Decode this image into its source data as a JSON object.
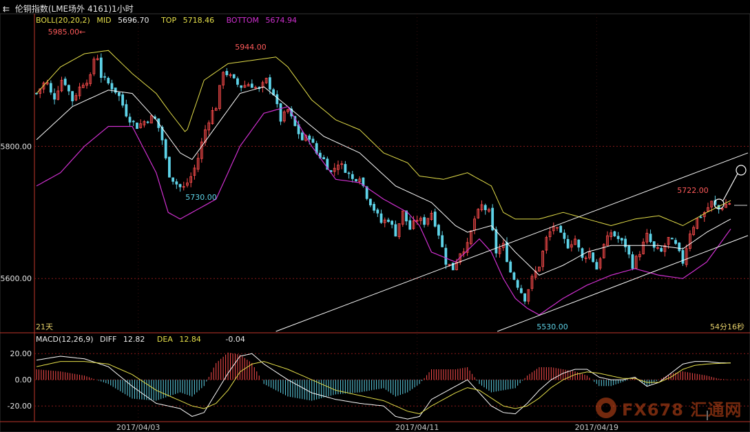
{
  "header": {
    "title": "伦铜指数(LME场外 4161)1小时",
    "title_icon": "back-arrows-icon"
  },
  "boll": {
    "name": "BOLL(20,20,2)",
    "mid_label": "MID",
    "mid_value": "5696.70",
    "top_label": "TOP",
    "top_value": "5718.46",
    "bottom_label": "BOTTOM",
    "bottom_value": "5674.94"
  },
  "macd": {
    "name": "MACD(12,26,9)",
    "diff_label": "DIFF",
    "diff_value": "12.82",
    "dea_label": "DEA",
    "dea_value": "12.84",
    "macd_value": "-0.04"
  },
  "footer": {
    "interval": "21天",
    "timer": "54分16秒"
  },
  "watermark": {
    "text": "FX678 汇通网"
  },
  "colors": {
    "up": "#ff4d4d",
    "down": "#5ed3e8",
    "mid": "#ffffff",
    "top": "#e6e04a",
    "bottom": "#d030d0",
    "grid": "#8a1a1a",
    "axis": "#c0392b",
    "price_annot_hi": "#ff5a5a",
    "price_annot_lo": "#5ed3e8",
    "trendline": "#ffffff"
  },
  "chart_data": [
    {
      "type": "candlestick",
      "title": "伦铜指数(LME场外 4161)1小时",
      "y_ticks": [
        5800.0,
        5600.0
      ],
      "y_tick_labels": [
        "5800.00",
        "5600.00"
      ],
      "ylim": [
        5520,
        5990
      ],
      "x_tick_labels": [
        "2017/04/03",
        "2017/04/11",
        "2017/04/19"
      ],
      "grid": true,
      "annotations": [
        {
          "label": "5985.00",
          "value": 5985.0,
          "kind": "high",
          "arrow": "←"
        },
        {
          "label": "5944.00",
          "value": 5944.0,
          "kind": "high"
        },
        {
          "label": "5730.00",
          "value": 5730.0,
          "kind": "low"
        },
        {
          "label": "5530.00",
          "value": 5530.0,
          "kind": "low"
        },
        {
          "label": "5722.00",
          "value": 5722.0,
          "kind": "high"
        }
      ],
      "close_path": [
        [
          0,
          5880
        ],
        [
          8,
          5900
        ],
        [
          14,
          5870
        ],
        [
          22,
          5905
        ],
        [
          30,
          5870
        ],
        [
          38,
          5895
        ],
        [
          46,
          5905
        ],
        [
          50,
          5960
        ],
        [
          52,
          5910
        ],
        [
          60,
          5895
        ],
        [
          68,
          5880
        ],
        [
          76,
          5845
        ],
        [
          84,
          5830
        ],
        [
          92,
          5840
        ],
        [
          98,
          5845
        ],
        [
          104,
          5820
        ],
        [
          110,
          5760
        ],
        [
          116,
          5745
        ],
        [
          122,
          5735
        ],
        [
          128,
          5750
        ],
        [
          134,
          5775
        ],
        [
          140,
          5820
        ],
        [
          146,
          5850
        ],
        [
          150,
          5860
        ],
        [
          156,
          5915
        ],
        [
          162,
          5905
        ],
        [
          170,
          5890
        ],
        [
          178,
          5895
        ],
        [
          186,
          5885
        ],
        [
          192,
          5900
        ],
        [
          198,
          5880
        ],
        [
          204,
          5840
        ],
        [
          210,
          5855
        ],
        [
          216,
          5830
        ],
        [
          222,
          5810
        ],
        [
          228,
          5815
        ],
        [
          234,
          5790
        ],
        [
          240,
          5780
        ],
        [
          246,
          5760
        ],
        [
          252,
          5775
        ],
        [
          258,
          5765
        ],
        [
          264,
          5750
        ],
        [
          270,
          5755
        ],
        [
          276,
          5725
        ],
        [
          282,
          5705
        ],
        [
          288,
          5685
        ],
        [
          294,
          5690
        ],
        [
          300,
          5668
        ],
        [
          306,
          5700
        ],
        [
          312,
          5675
        ],
        [
          318,
          5690
        ],
        [
          324,
          5685
        ],
        [
          330,
          5700
        ],
        [
          336,
          5668
        ],
        [
          342,
          5625
        ],
        [
          348,
          5615
        ],
        [
          354,
          5640
        ],
        [
          360,
          5650
        ],
        [
          366,
          5690
        ],
        [
          372,
          5710
        ],
        [
          378,
          5700
        ],
        [
          384,
          5640
        ],
        [
          390,
          5650
        ],
        [
          396,
          5610
        ],
        [
          402,
          5590
        ],
        [
          408,
          5570
        ],
        [
          414,
          5600
        ],
        [
          420,
          5620
        ],
        [
          426,
          5660
        ],
        [
          432,
          5680
        ],
        [
          438,
          5665
        ],
        [
          444,
          5650
        ],
        [
          450,
          5660
        ],
        [
          456,
          5630
        ],
        [
          462,
          5640
        ],
        [
          468,
          5615
        ],
        [
          474,
          5650
        ],
        [
          480,
          5670
        ],
        [
          486,
          5660
        ],
        [
          492,
          5650
        ],
        [
          498,
          5620
        ],
        [
          504,
          5640
        ],
        [
          510,
          5665
        ],
        [
          516,
          5645
        ],
        [
          522,
          5640
        ],
        [
          528,
          5660
        ],
        [
          534,
          5650
        ],
        [
          540,
          5625
        ],
        [
          546,
          5670
        ],
        [
          552,
          5690
        ],
        [
          558,
          5700
        ],
        [
          564,
          5715
        ],
        [
          570,
          5705
        ],
        [
          576,
          5712
        ],
        [
          580,
          5715
        ]
      ],
      "boll_mid": [
        [
          0,
          5810
        ],
        [
          30,
          5860
        ],
        [
          60,
          5885
        ],
        [
          80,
          5880
        ],
        [
          100,
          5840
        ],
        [
          120,
          5790
        ],
        [
          130,
          5780
        ],
        [
          150,
          5830
        ],
        [
          170,
          5880
        ],
        [
          190,
          5890
        ],
        [
          210,
          5860
        ],
        [
          240,
          5815
        ],
        [
          270,
          5790
        ],
        [
          300,
          5740
        ],
        [
          330,
          5715
        ],
        [
          350,
          5680
        ],
        [
          360,
          5670
        ],
        [
          380,
          5680
        ],
        [
          400,
          5640
        ],
        [
          420,
          5605
        ],
        [
          440,
          5620
        ],
        [
          460,
          5640
        ],
        [
          480,
          5650
        ],
        [
          500,
          5650
        ],
        [
          520,
          5650
        ],
        [
          540,
          5645
        ],
        [
          560,
          5670
        ],
        [
          580,
          5690
        ]
      ],
      "boll_top": [
        [
          0,
          5880
        ],
        [
          20,
          5920
        ],
        [
          40,
          5940
        ],
        [
          60,
          5945
        ],
        [
          80,
          5910
        ],
        [
          100,
          5880
        ],
        [
          110,
          5855
        ],
        [
          125,
          5820
        ],
        [
          140,
          5900
        ],
        [
          160,
          5925
        ],
        [
          180,
          5930
        ],
        [
          200,
          5935
        ],
        [
          210,
          5920
        ],
        [
          230,
          5870
        ],
        [
          250,
          5840
        ],
        [
          270,
          5825
        ],
        [
          290,
          5790
        ],
        [
          310,
          5775
        ],
        [
          320,
          5755
        ],
        [
          340,
          5750
        ],
        [
          360,
          5760
        ],
        [
          380,
          5740
        ],
        [
          390,
          5700
        ],
        [
          400,
          5690
        ],
        [
          420,
          5690
        ],
        [
          440,
          5700
        ],
        [
          460,
          5690
        ],
        [
          480,
          5680
        ],
        [
          500,
          5690
        ],
        [
          520,
          5695
        ],
        [
          540,
          5680
        ],
        [
          560,
          5700
        ],
        [
          580,
          5718
        ]
      ],
      "boll_bottom": [
        [
          0,
          5740
        ],
        [
          20,
          5760
        ],
        [
          40,
          5800
        ],
        [
          60,
          5830
        ],
        [
          80,
          5830
        ],
        [
          100,
          5760
        ],
        [
          110,
          5700
        ],
        [
          120,
          5690
        ],
        [
          130,
          5700
        ],
        [
          150,
          5720
        ],
        [
          170,
          5800
        ],
        [
          190,
          5850
        ],
        [
          210,
          5860
        ],
        [
          230,
          5800
        ],
        [
          250,
          5750
        ],
        [
          270,
          5745
        ],
        [
          290,
          5720
        ],
        [
          310,
          5700
        ],
        [
          320,
          5680
        ],
        [
          330,
          5640
        ],
        [
          350,
          5625
        ],
        [
          370,
          5660
        ],
        [
          380,
          5640
        ],
        [
          390,
          5600
        ],
        [
          400,
          5570
        ],
        [
          410,
          5555
        ],
        [
          420,
          5545
        ],
        [
          440,
          5570
        ],
        [
          460,
          5590
        ],
        [
          480,
          5605
        ],
        [
          500,
          5615
        ],
        [
          520,
          5605
        ],
        [
          540,
          5600
        ],
        [
          560,
          5625
        ],
        [
          580,
          5675
        ]
      ],
      "trendlines": [
        {
          "name": "channel-upper",
          "from": [
            200,
            5520
          ],
          "to": [
            580,
            5790
          ]
        },
        {
          "name": "channel-lower",
          "from": [
            385,
            5520
          ],
          "to": [
            580,
            5665
          ]
        }
      ]
    },
    {
      "type": "macd",
      "y_ticks": [
        20.0,
        0.0,
        -20.0
      ],
      "y_tick_labels": [
        "20.00",
        "0.00",
        "-20.00"
      ],
      "ylim": [
        -32,
        28
      ],
      "series": [
        {
          "name": "DIFF",
          "values_path": [
            [
              0,
              15
            ],
            [
              20,
              18
            ],
            [
              40,
              16
            ],
            [
              60,
              10
            ],
            [
              80,
              -5
            ],
            [
              100,
              -18
            ],
            [
              120,
              -22
            ],
            [
              130,
              -28
            ],
            [
              140,
              -25
            ],
            [
              150,
              -10
            ],
            [
              160,
              5
            ],
            [
              170,
              18
            ],
            [
              180,
              20
            ],
            [
              190,
              12
            ],
            [
              210,
              0
            ],
            [
              230,
              -10
            ],
            [
              250,
              -15
            ],
            [
              270,
              -18
            ],
            [
              290,
              -20
            ],
            [
              300,
              -28
            ],
            [
              310,
              -30
            ],
            [
              320,
              -28
            ],
            [
              330,
              -15
            ],
            [
              340,
              -10
            ],
            [
              350,
              -5
            ],
            [
              360,
              0
            ],
            [
              370,
              -10
            ],
            [
              380,
              -20
            ],
            [
              390,
              -25
            ],
            [
              400,
              -26
            ],
            [
              410,
              -18
            ],
            [
              420,
              -8
            ],
            [
              430,
              0
            ],
            [
              440,
              5
            ],
            [
              450,
              8
            ],
            [
              460,
              8
            ],
            [
              470,
              2
            ],
            [
              480,
              0
            ],
            [
              490,
              0
            ],
            [
              500,
              2
            ],
            [
              510,
              -5
            ],
            [
              520,
              -2
            ],
            [
              530,
              5
            ],
            [
              540,
              12
            ],
            [
              550,
              14
            ],
            [
              560,
              14
            ],
            [
              570,
              13
            ],
            [
              580,
              12.82
            ]
          ]
        },
        {
          "name": "DEA",
          "values_path": [
            [
              0,
              10
            ],
            [
              20,
              14
            ],
            [
              40,
              14
            ],
            [
              60,
              12
            ],
            [
              80,
              4
            ],
            [
              100,
              -8
            ],
            [
              120,
              -16
            ],
            [
              130,
              -20
            ],
            [
              140,
              -22
            ],
            [
              150,
              -18
            ],
            [
              160,
              -8
            ],
            [
              170,
              6
            ],
            [
              180,
              12
            ],
            [
              190,
              14
            ],
            [
              210,
              8
            ],
            [
              230,
              0
            ],
            [
              250,
              -8
            ],
            [
              270,
              -12
            ],
            [
              290,
              -16
            ],
            [
              300,
              -20
            ],
            [
              310,
              -24
            ],
            [
              320,
              -26
            ],
            [
              330,
              -20
            ],
            [
              340,
              -15
            ],
            [
              350,
              -10
            ],
            [
              360,
              -6
            ],
            [
              370,
              -8
            ],
            [
              380,
              -14
            ],
            [
              390,
              -20
            ],
            [
              400,
              -22
            ],
            [
              410,
              -20
            ],
            [
              420,
              -14
            ],
            [
              430,
              -6
            ],
            [
              440,
              0
            ],
            [
              450,
              4
            ],
            [
              460,
              6
            ],
            [
              470,
              5
            ],
            [
              480,
              3
            ],
            [
              490,
              1
            ],
            [
              500,
              1
            ],
            [
              510,
              -2
            ],
            [
              520,
              -2
            ],
            [
              530,
              2
            ],
            [
              540,
              8
            ],
            [
              550,
              11
            ],
            [
              560,
              12
            ],
            [
              570,
              12.5
            ],
            [
              580,
              12.84
            ]
          ]
        }
      ]
    }
  ]
}
